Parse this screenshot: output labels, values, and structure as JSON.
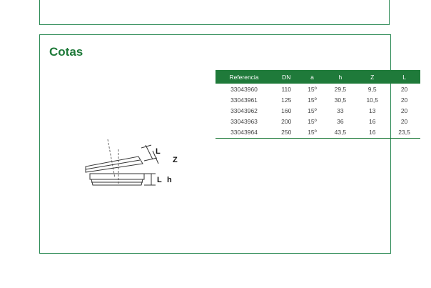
{
  "section": {
    "title": "Cotas"
  },
  "table": {
    "headers": [
      "Referencia",
      "DN",
      "a",
      "h",
      "Z",
      "L"
    ],
    "rows": [
      [
        "33043960",
        "110",
        "15º",
        "29,5",
        "9,5",
        "20"
      ],
      [
        "33043961",
        "125",
        "15º",
        "30,5",
        "10,5",
        "20"
      ],
      [
        "33043962",
        "160",
        "15º",
        "33",
        "13",
        "20"
      ],
      [
        "33043963",
        "200",
        "15º",
        "36",
        "16",
        "20"
      ],
      [
        "33043964",
        "250",
        "15º",
        "43,5",
        "16",
        "23,5"
      ]
    ]
  },
  "drawing": {
    "labels": {
      "l_top": "L",
      "z": "Z",
      "l_bottom": "L",
      "h": "h"
    }
  },
  "colors": {
    "accent": "#1f7a3a",
    "border": "#2e8b57"
  }
}
